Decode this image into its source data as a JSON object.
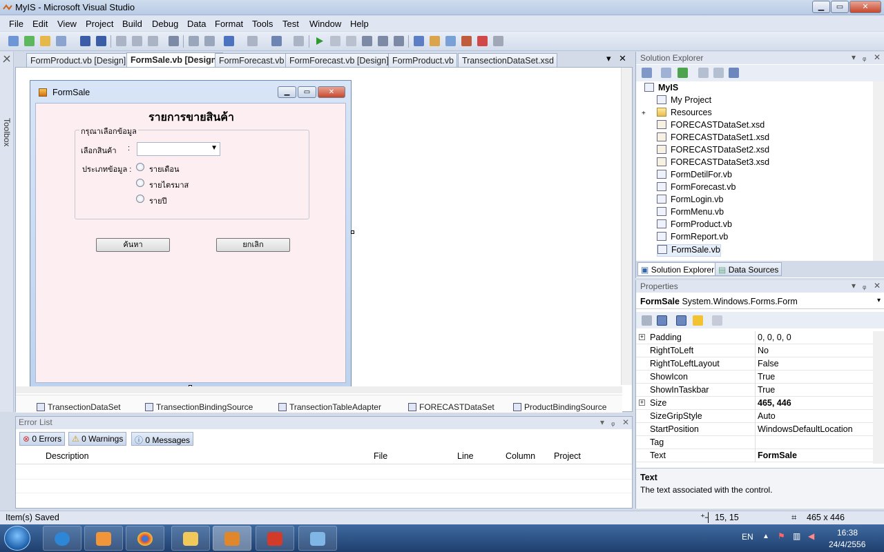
{
  "window": {
    "title": "MyIS - Microsoft Visual Studio",
    "min": "▁",
    "max": "▭",
    "close": "✕"
  },
  "menu": [
    "File",
    "Edit",
    "View",
    "Project",
    "Build",
    "Debug",
    "Data",
    "Format",
    "Tools",
    "Test",
    "Window",
    "Help"
  ],
  "toolbox": {
    "label": "Toolbox"
  },
  "doc_tabs": [
    {
      "label": "FormProduct.vb [Design]",
      "active": false
    },
    {
      "label": "FormSale.vb [Design]",
      "active": true
    },
    {
      "label": "FormForecast.vb",
      "active": false
    },
    {
      "label": "FormForecast.vb [Design]",
      "active": false
    },
    {
      "label": "FormProduct.vb",
      "active": false
    },
    {
      "label": "TransectionDataSet.xsd",
      "active": false
    }
  ],
  "tab_controls": {
    "dropdown": "▾",
    "close": "✕"
  },
  "design_form": {
    "title": "FormSale",
    "heading": "รายการขายสินค้า",
    "group_legend": "กรุณาเลือกข้อมูล",
    "product_label": "เลือกสินค้า",
    "colon": ":",
    "type_label": "ประเภทข้อมูล :",
    "radio_options": [
      "รายเดือน",
      "รายไตรมาส",
      "รายปี"
    ],
    "search_button": "ค้นหา",
    "cancel_button": "ยกเลิก"
  },
  "component_tray": [
    "TransectionDataSet",
    "TransectionBindingSource",
    "TransectionTableAdapter",
    "FORECASTDataSet",
    "ProductBindingSource"
  ],
  "error_list": {
    "title": "Error List",
    "errors": "0 Errors",
    "warnings": "0 Warnings",
    "messages": "0 Messages",
    "columns": [
      "Description",
      "File",
      "Line",
      "Column",
      "Project"
    ]
  },
  "solution_explorer": {
    "title": "Solution Explorer",
    "root": "MyIS",
    "items": [
      {
        "label": "My Project",
        "kind": "project"
      },
      {
        "label": "Resources",
        "kind": "folder"
      },
      {
        "label": "FORECASTDataSet.xsd",
        "kind": "xsd"
      },
      {
        "label": "FORECASTDataSet1.xsd",
        "kind": "xsd"
      },
      {
        "label": "FORECASTDataSet2.xsd",
        "kind": "xsd"
      },
      {
        "label": "FORECASTDataSet3.xsd",
        "kind": "xsd"
      },
      {
        "label": "FormDetilFor.vb",
        "kind": "form"
      },
      {
        "label": "FormForecast.vb",
        "kind": "form"
      },
      {
        "label": "FormLogin.vb",
        "kind": "form"
      },
      {
        "label": "FormMenu.vb",
        "kind": "form"
      },
      {
        "label": "FormProduct.vb",
        "kind": "form"
      },
      {
        "label": "FormReport.vb",
        "kind": "form"
      },
      {
        "label": "FormSale.vb",
        "kind": "form"
      }
    ],
    "tabs": [
      "Solution Explorer",
      "Data Sources"
    ]
  },
  "properties": {
    "title": "Properties",
    "object_name": "FormSale",
    "object_type": "System.Windows.Forms.Form",
    "rows": [
      {
        "name": "Padding",
        "value": "0, 0, 0, 0",
        "expandable": true,
        "bold": false
      },
      {
        "name": "RightToLeft",
        "value": "No",
        "expandable": false,
        "bold": false
      },
      {
        "name": "RightToLeftLayout",
        "value": "False",
        "expandable": false,
        "bold": false
      },
      {
        "name": "ShowIcon",
        "value": "True",
        "expandable": false,
        "bold": false
      },
      {
        "name": "ShowInTaskbar",
        "value": "True",
        "expandable": false,
        "bold": false
      },
      {
        "name": "Size",
        "value": "465, 446",
        "expandable": true,
        "bold": true
      },
      {
        "name": "SizeGripStyle",
        "value": "Auto",
        "expandable": false,
        "bold": false
      },
      {
        "name": "StartPosition",
        "value": "WindowsDefaultLocation",
        "expandable": false,
        "bold": false
      },
      {
        "name": "Tag",
        "value": "",
        "expandable": false,
        "bold": false
      },
      {
        "name": "Text",
        "value": "FormSale",
        "expandable": false,
        "bold": true
      }
    ],
    "desc_title": "Text",
    "desc_text": "The text associated with the control."
  },
  "status": {
    "message": "Item(s) Saved",
    "position": "15, 15",
    "size": "465 x 446"
  },
  "taskbar": {
    "lang": "EN",
    "time": "16:38",
    "date": "24/4/2556"
  }
}
